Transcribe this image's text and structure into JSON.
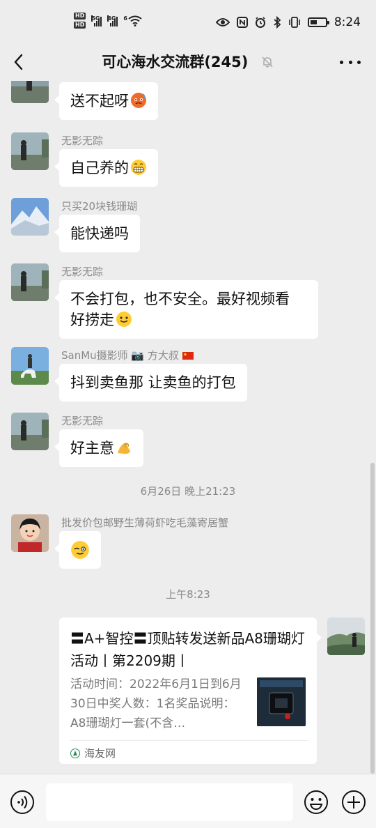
{
  "status_bar": {
    "left_badges": [
      "HD",
      "HD"
    ],
    "signal_tags": [
      "5G",
      "4G",
      "6"
    ],
    "time": "8:24",
    "icons": [
      "eye-icon",
      "nfc-icon",
      "alarm-icon",
      "bluetooth-icon",
      "vibrate-icon",
      "battery-icon"
    ]
  },
  "header": {
    "title": "可心海水交流群(245)",
    "back_icon": "chevron-left-icon",
    "mute_icon": "bell-off-icon",
    "more_icon": "more-dots-icon"
  },
  "messages": [
    {
      "sender": "",
      "text": "送不起呀"
    },
    {
      "sender": "无影无踪",
      "text": "自己养的"
    },
    {
      "sender": "只买20块钱珊瑚",
      "text": "能快递吗"
    },
    {
      "sender": "无影无踪",
      "text_line1": "不会打包，也不安全。最好视频看",
      "text_line2": "好捞走"
    },
    {
      "sender": "SanMu摄影师 📷 方大叔",
      "text": "抖到卖鱼那 让卖鱼的打包"
    },
    {
      "sender": "无影无踪",
      "text": "好主意"
    },
    {
      "sender": "批发价包邮野生薄荷虾吃毛藻寄居蟹",
      "text": ""
    }
  ],
  "time_separators": [
    "6月26日 晚上21:23",
    "上午8:23"
  ],
  "link_card": {
    "title": "〓A+智控〓顶贴转发送新品A8珊瑚灯活动丨第2209期丨",
    "description": "活动时间：2022年6月1日到6月30日中奖人数：1名奖品说明：A8珊瑚灯一套(不含…",
    "source": "海友网"
  },
  "input_bar": {
    "voice_icon": "voice-icon",
    "emoji_icon": "emoji-icon",
    "plus_icon": "plus-circle-icon",
    "placeholder": ""
  },
  "colors": {
    "background": "#ededed",
    "bubble": "#ffffff",
    "meta_text": "#8a8a8a"
  }
}
